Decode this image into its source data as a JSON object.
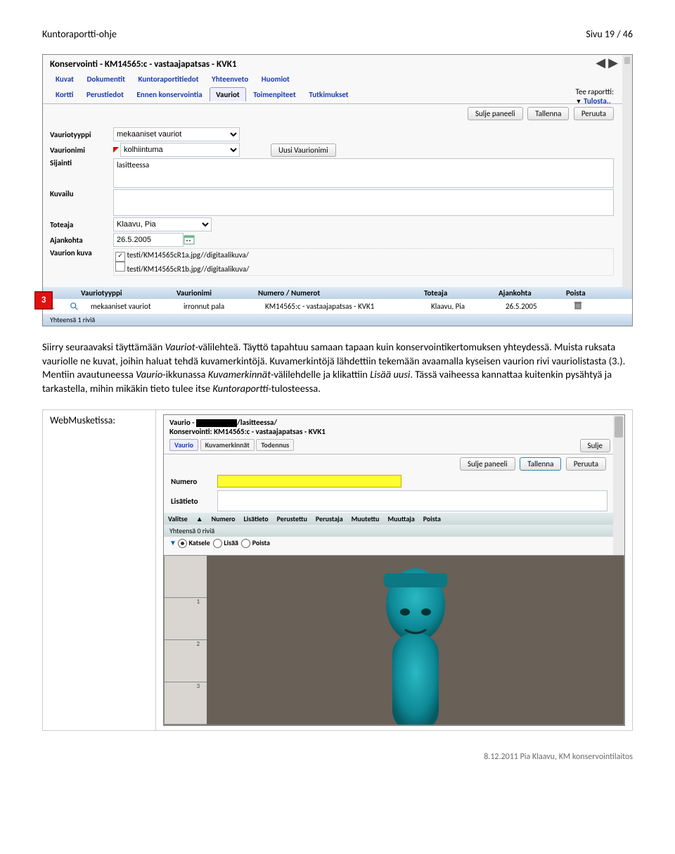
{
  "doc": {
    "header_left": "Kuntoraportti-ohje",
    "header_right": "Sivu 19 / 46",
    "footer": "8.12.2011 Pia Klaavu, KM konservointilaitos"
  },
  "sc1": {
    "title": "Konservointi  - KM14565:c - vastaajapatsas - KVK1",
    "tabs1": [
      "Kuvat",
      "Dokumentit",
      "Kuntoraportitiedot",
      "Yhteenveto",
      "Huomiot"
    ],
    "tabs2": [
      "Kortti",
      "Perustiedot",
      "Ennen konservointia",
      "Vauriot",
      "Toimenpiteet",
      "Tutkimukset"
    ],
    "tabs2_active_index": 3,
    "report_lbl": "Tee raportti:",
    "print_link": "Tulosta..",
    "btn_close": "Sulje paneeli",
    "btn_save": "Tallenna",
    "btn_cancel": "Peruuta",
    "form": {
      "vauriotyyppi_lbl": "Vauriotyyppi",
      "vauriotyyppi_val": "mekaaniset vauriot",
      "vaurionimi_lbl": "Vaurionimi",
      "vaurionimi_val": "kolhiintuma",
      "uusi_vaurionimi": "Uusi Vaurionimi",
      "sijainti_lbl": "Sijainti",
      "sijainti_val": "lasitteessa",
      "kuvailu_lbl": "Kuvailu",
      "toteaja_lbl": "Toteaja",
      "toteaja_val": "Klaavu, Pia",
      "ajankohta_lbl": "Ajankohta",
      "ajankohta_val": "26.5.2005",
      "vaurionkuva_lbl": "Vaurion kuva",
      "file1": "testi/KM14565cR1a.jpg//digitaalikuva/",
      "file2": "testi/KM14565cR1b.jpg//digitaalikuva/"
    },
    "grid": {
      "headers": [
        "Vauriotyyppi",
        "Vaurionimi",
        "Numero / Numerot",
        "Toteaja",
        "Ajankohta",
        "Poista"
      ],
      "row_prefix": "1.",
      "cells": [
        "mekaaniset vauriot",
        "irronnut pala",
        "KM14565:c - vastaajapatsas - KVK1",
        "Klaavu, Pia",
        "26.5.2005"
      ],
      "summary": "Yhteensä 1 riviä"
    },
    "badge": "3"
  },
  "paragraph": {
    "text1": "Siirry seuraavaksi täyttämään ",
    "em1": "Vauriot",
    "text2": "-välilehteä. Täyttö tapahtuu samaan tapaan kuin konservointikertomuksen yhteydessä. Muista ruksata vauriolle ne kuvat, joihin haluat tehdä kuvamerkintöjä. Kuvamerkintöjä lähdettiin tekemään avaamalla kyseisen vaurion rivi vauriolistasta (3.). Mentiin avautuneessa ",
    "em2": "Vaurio",
    "text3": "-ikkunassa ",
    "em3": "Kuvamerkinnät",
    "text4": "-välilehdelle ja klikattiin ",
    "em4": "Lisää uusi",
    "text5": ". Tässä vaiheessa kannattaa kuitenkin pysähtyä ja tarkastella, mihin mikäkin tieto tulee itse ",
    "em5": "Kuntoraportti",
    "text6": "-tulosteessa."
  },
  "table_label": "WebMusketissa:",
  "sc2": {
    "title_pre": "Vaurio - ",
    "title_post": "/lasitteessa/",
    "subtitle": "Konservointi: KM14565:c - vastaajapatsas - KVK1",
    "tabs": [
      "Vaurio",
      "Kuvamerkinnät",
      "Todennus"
    ],
    "btn_sulje": "Sulje",
    "btn_close": "Sulje paneeli",
    "btn_save": "Tallenna",
    "btn_cancel": "Peruuta",
    "numero_lbl": "Numero",
    "lisatieto_lbl": "Lisätieto",
    "gridheaders": [
      "Valitse",
      "Numero",
      "Lisätieto",
      "Perustettu",
      "Perustaja",
      "Muutettu",
      "Muuttaja",
      "Poista"
    ],
    "summary": "Yhteensä 0 riviä",
    "katsele": "Katsele",
    "lisaa": "Lisää",
    "poista": "Poista"
  },
  "ruler_ticks": [
    "",
    "1",
    "2",
    "3"
  ]
}
